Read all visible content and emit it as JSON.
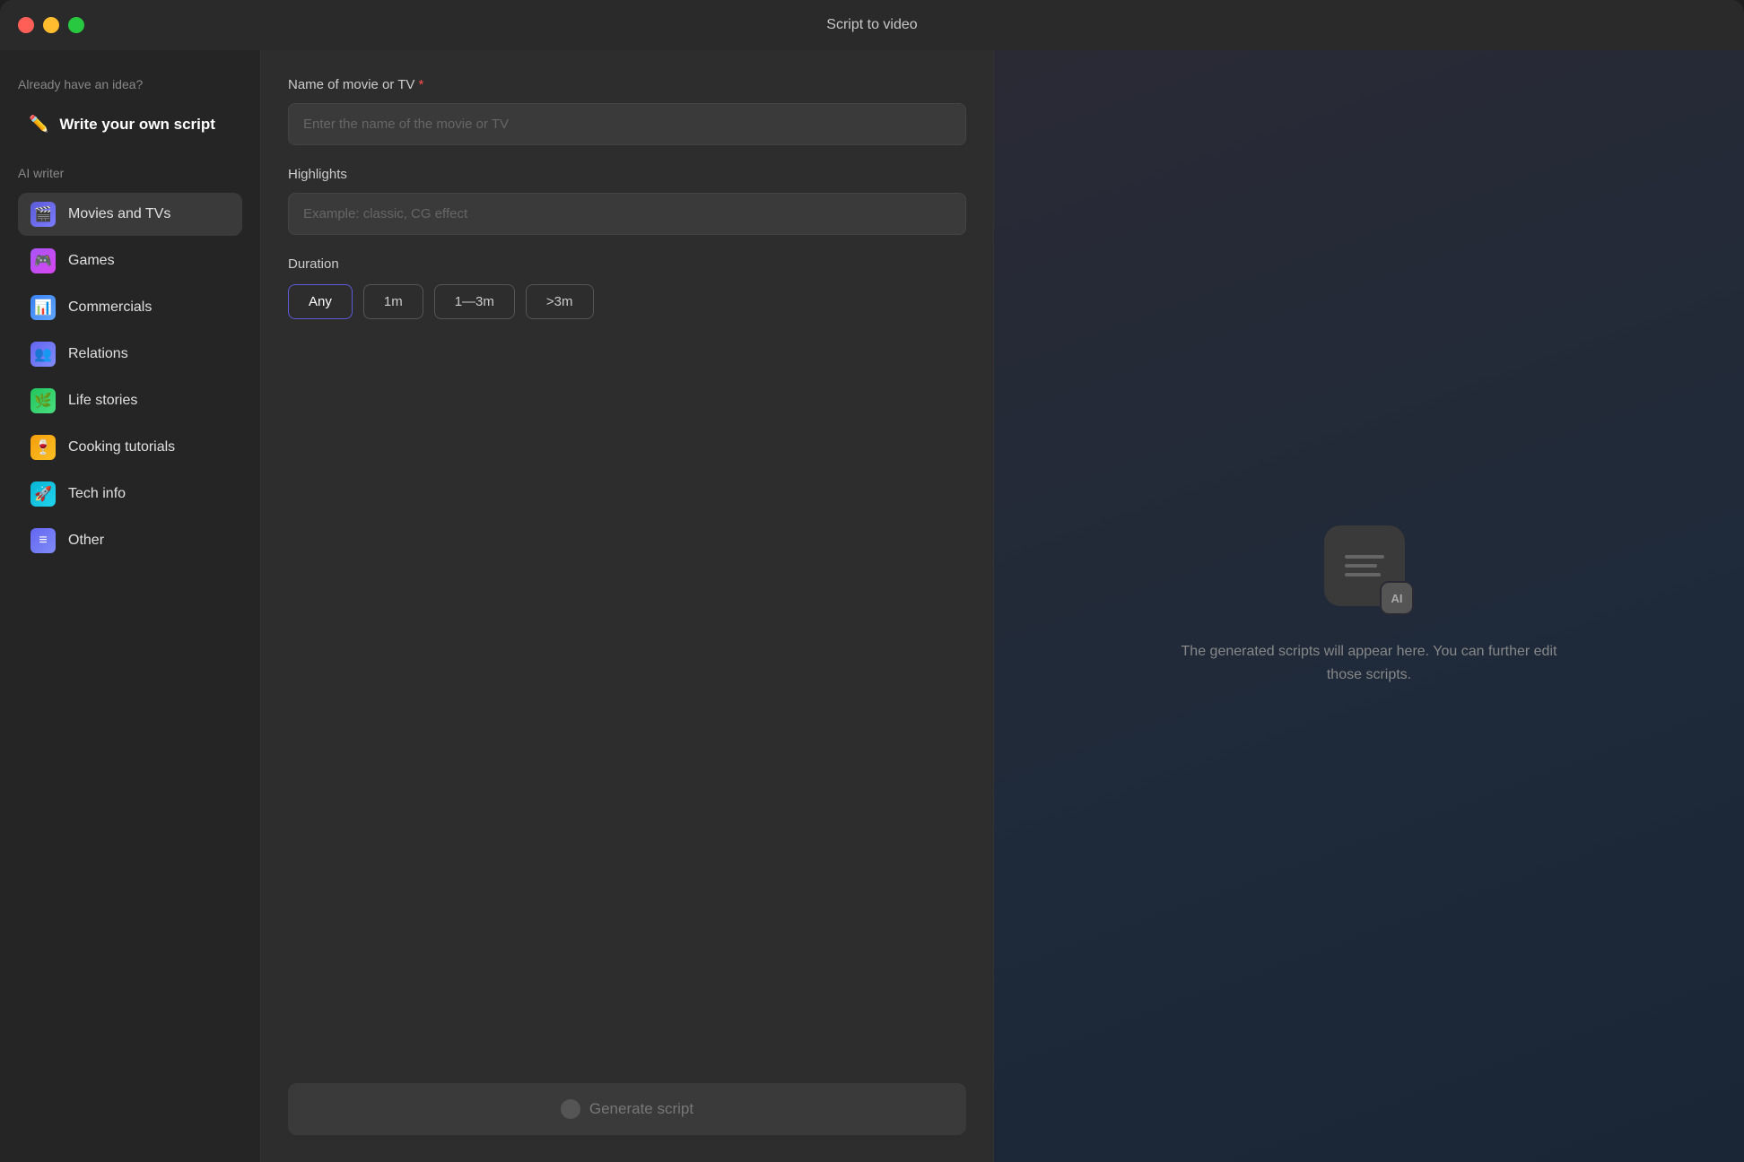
{
  "window": {
    "title": "Script to video"
  },
  "sidebar": {
    "already_label": "Already have an idea?",
    "write_script_label": "Write your own script",
    "ai_writer_label": "AI writer",
    "items": [
      {
        "id": "movies",
        "label": "Movies and TVs",
        "icon_class": "icon-movies",
        "icon_emoji": "🎬",
        "active": true
      },
      {
        "id": "games",
        "label": "Games",
        "icon_class": "icon-games",
        "icon_emoji": "🎮"
      },
      {
        "id": "commercials",
        "label": "Commercials",
        "icon_class": "icon-commercials",
        "icon_emoji": "📊"
      },
      {
        "id": "relations",
        "label": "Relations",
        "icon_class": "icon-relations",
        "icon_emoji": "👥"
      },
      {
        "id": "life-stories",
        "label": "Life stories",
        "icon_class": "icon-life",
        "icon_emoji": "🌿"
      },
      {
        "id": "cooking",
        "label": "Cooking tutorials",
        "icon_class": "icon-cooking",
        "icon_emoji": "🍷"
      },
      {
        "id": "tech",
        "label": "Tech info",
        "icon_class": "icon-tech",
        "icon_emoji": "🚀"
      },
      {
        "id": "other",
        "label": "Other",
        "icon_class": "icon-other",
        "icon_emoji": "≡"
      }
    ]
  },
  "center": {
    "name_label": "Name of movie or TV",
    "name_placeholder": "Enter the name of the movie or TV",
    "highlights_label": "Highlights",
    "highlights_placeholder": "Example: classic, CG effect",
    "duration_label": "Duration",
    "duration_options": [
      {
        "id": "any",
        "label": "Any",
        "selected": true
      },
      {
        "id": "1m",
        "label": "1m",
        "selected": false
      },
      {
        "id": "1-3m",
        "label": "1—3m",
        "selected": false
      },
      {
        "id": "3m+",
        "label": ">3m",
        "selected": false
      }
    ],
    "generate_btn_label": "Generate script"
  },
  "right": {
    "ai_badge": "AI",
    "placeholder_text": "The generated scripts will appear here. You can further edit those scripts."
  }
}
